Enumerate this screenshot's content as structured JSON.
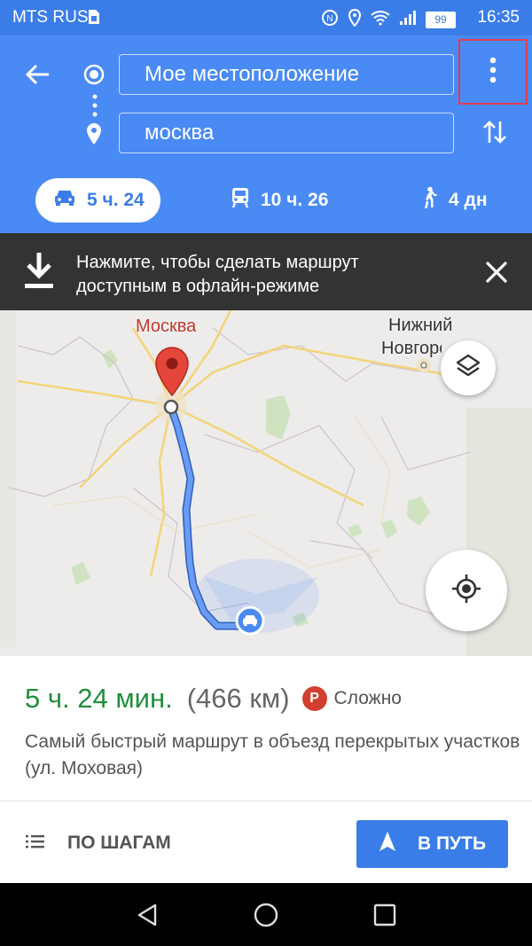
{
  "status_bar": {
    "carrier": "MTS RUS",
    "battery": "99",
    "time": "16:35"
  },
  "header": {
    "origin": "Мое местоположение",
    "destination": "москва",
    "modes": [
      {
        "icon": "car-icon",
        "label": "5 ч. 24",
        "active": true
      },
      {
        "icon": "transit-icon",
        "label": "10 ч. 26",
        "active": false
      },
      {
        "icon": "walk-icon",
        "label": "4 дн",
        "active": false
      }
    ]
  },
  "banner": {
    "text": "Нажмите, чтобы сделать маршрут доступным в офлайн-режиме"
  },
  "map": {
    "labels": {
      "moscow": "Москва",
      "nizhny_line1": "Нижний",
      "nizhny_line2": "Новгород"
    }
  },
  "route": {
    "duration": "5 ч. 24 мин.",
    "distance": "(466 км)",
    "traffic_badge": "P",
    "traffic_status": "Сложно",
    "description": "Самый быстрый маршрут в объезд перекрытых участков (ул. Моховая)"
  },
  "actions": {
    "steps_label": "ПО ШАГАМ",
    "go_label": "В ПУТЬ"
  },
  "colors": {
    "header_blue": "#4a8af4",
    "accent_blue": "#3b7de8",
    "duration_green": "#1f8e3d",
    "traffic_red": "#d23f31",
    "highlight_box": "#e53a4f"
  }
}
